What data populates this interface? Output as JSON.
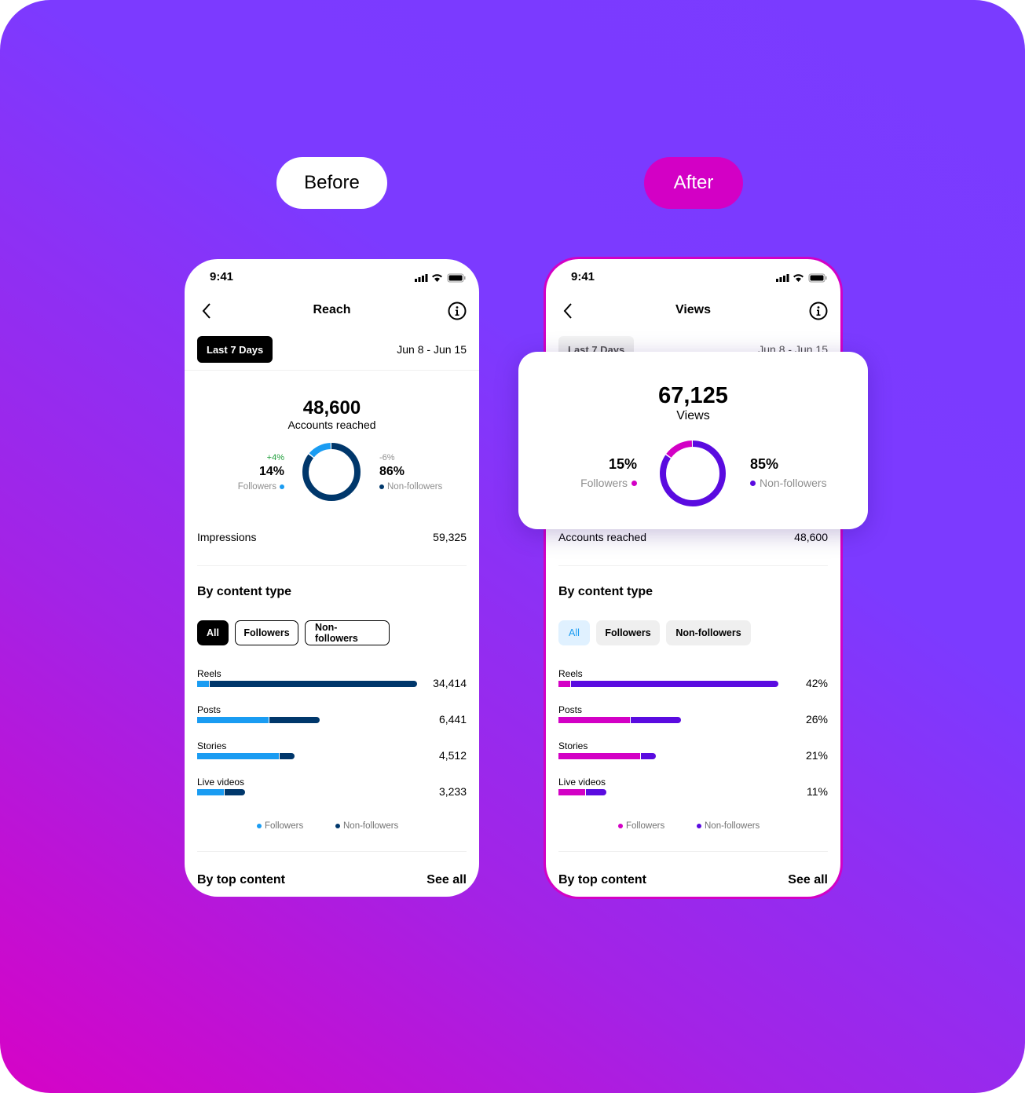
{
  "labels": {
    "before": "Before",
    "after": "After"
  },
  "colors": {
    "before_followers": "#1a9cf2",
    "before_nonfollowers": "#00376b",
    "after_followers": "#d300c5",
    "after_nonfollowers": "#5a0be0",
    "after_accent": "#d300c5"
  },
  "before": {
    "time": "9:41",
    "title": "Reach",
    "range_chip": "Last 7 Days",
    "date_range": "Jun 8 - Jun 15",
    "total": "48,600",
    "total_label": "Accounts reached",
    "followers": {
      "pct": "14%",
      "change": "+4%",
      "label": "Followers",
      "share": 14
    },
    "nonfollowers": {
      "pct": "86%",
      "change": "-6%",
      "label": "Non-followers",
      "share": 86
    },
    "stat_row": {
      "label": "Impressions",
      "value": "59,325"
    },
    "section": "By content type",
    "tabs": [
      "All",
      "Followers",
      "Non-followers"
    ],
    "rows": [
      {
        "label": "Reels",
        "value": "34,414",
        "fill": 1.0,
        "followers_share": 0.057
      },
      {
        "label": "Posts",
        "value": "6,441",
        "fill": 0.557,
        "followers_share": 0.59
      },
      {
        "label": "Stories",
        "value": "4,512",
        "fill": 0.443,
        "followers_share": 0.85
      },
      {
        "label": "Live videos",
        "value": "3,233",
        "fill": 0.218,
        "followers_share": 0.57
      }
    ],
    "legend": [
      "Followers",
      "Non-followers"
    ],
    "footer": {
      "title": "By top content",
      "link": "See all"
    }
  },
  "after": {
    "time": "9:41",
    "title": "Views",
    "range_chip": "Last 7 Days",
    "date_range": "Jun 8 - Jun 15",
    "total": "67,125",
    "total_label": "Views",
    "followers": {
      "pct": "15%",
      "label": "Followers",
      "share": 15
    },
    "nonfollowers": {
      "pct": "85%",
      "label": "Non-followers",
      "share": 85
    },
    "stat_row": {
      "label": "Accounts reached",
      "value": "48,600"
    },
    "section": "By content type",
    "tabs": [
      "All",
      "Followers",
      "Non-followers"
    ],
    "rows": [
      {
        "label": "Reels",
        "value": "42%",
        "fill": 1.0,
        "followers_share": 0.057
      },
      {
        "label": "Posts",
        "value": "26%",
        "fill": 0.557,
        "followers_share": 0.59
      },
      {
        "label": "Stories",
        "value": "21%",
        "fill": 0.443,
        "followers_share": 0.85
      },
      {
        "label": "Live videos",
        "value": "11%",
        "fill": 0.218,
        "followers_share": 0.57
      }
    ],
    "legend": [
      "Followers",
      "Non-followers"
    ],
    "footer": {
      "title": "By top content",
      "link": "See all"
    }
  }
}
